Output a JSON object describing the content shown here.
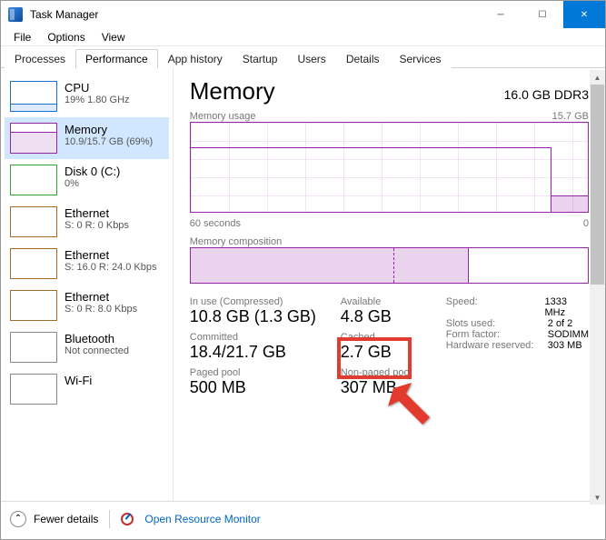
{
  "window": {
    "title": "Task Manager"
  },
  "menu": [
    "File",
    "Options",
    "View"
  ],
  "tabs": [
    "Processes",
    "Performance",
    "App history",
    "Startup",
    "Users",
    "Details",
    "Services"
  ],
  "activeTab": 1,
  "sidebar": [
    {
      "title": "CPU",
      "sub": "19% 1.80 GHz",
      "cls": "cpu"
    },
    {
      "title": "Memory",
      "sub": "10.9/15.7 GB (69%)",
      "cls": "mem",
      "selected": true
    },
    {
      "title": "Disk 0 (C:)",
      "sub": "0%",
      "cls": "disk"
    },
    {
      "title": "Ethernet",
      "sub": "S: 0 R: 0 Kbps",
      "cls": "eth"
    },
    {
      "title": "Ethernet",
      "sub": "S: 16.0 R: 24.0 Kbps",
      "cls": "eth"
    },
    {
      "title": "Ethernet",
      "sub": "S: 0 R: 8.0 Kbps",
      "cls": "eth"
    },
    {
      "title": "Bluetooth",
      "sub": "Not connected",
      "cls": "bt"
    },
    {
      "title": "Wi-Fi",
      "sub": "",
      "cls": "bt"
    }
  ],
  "main": {
    "title": "Memory",
    "capacity": "16.0 GB DDR3",
    "usageLabel": "Memory usage",
    "usageMax": "15.7 GB",
    "timeLabel": "60 seconds",
    "timeZero": "0",
    "compLabel": "Memory composition",
    "stats": {
      "inuse_lbl": "In use (Compressed)",
      "inuse_val": "10.8 GB (1.3 GB)",
      "avail_lbl": "Available",
      "avail_val": "4.8 GB",
      "committed_lbl": "Committed",
      "committed_val": "18.4/21.7 GB",
      "cached_lbl": "Cached",
      "cached_val": "2.7 GB",
      "paged_lbl": "Paged pool",
      "paged_val": "500 MB",
      "nonpaged_lbl": "Non-paged pool",
      "nonpaged_val": "307 MB"
    },
    "meta": {
      "speed_lbl": "Speed:",
      "speed_val": "1333 MHz",
      "slots_lbl": "Slots used:",
      "slots_val": "2 of 2",
      "form_lbl": "Form factor:",
      "form_val": "SODIMM",
      "hw_lbl": "Hardware reserved:",
      "hw_val": "303 MB"
    }
  },
  "footer": {
    "fewer": "Fewer details",
    "rm": "Open Resource Monitor"
  },
  "chart_data": {
    "type": "line",
    "title": "Memory usage",
    "xlabel": "60 seconds",
    "ylabel": "GB",
    "ylim": [
      0,
      15.7
    ],
    "x_seconds_ago": [
      60,
      55,
      50,
      45,
      40,
      35,
      30,
      25,
      20,
      15,
      10,
      5,
      0
    ],
    "values_gb": [
      10.9,
      10.9,
      10.9,
      10.9,
      10.9,
      10.9,
      10.9,
      10.9,
      10.9,
      10.9,
      10.9,
      2.8,
      2.8
    ],
    "composition": {
      "in_use_gb": 10.8,
      "modified_gb": 0,
      "standby_gb": 2.7,
      "free_gb": 2.1,
      "total_gb": 15.7
    }
  }
}
